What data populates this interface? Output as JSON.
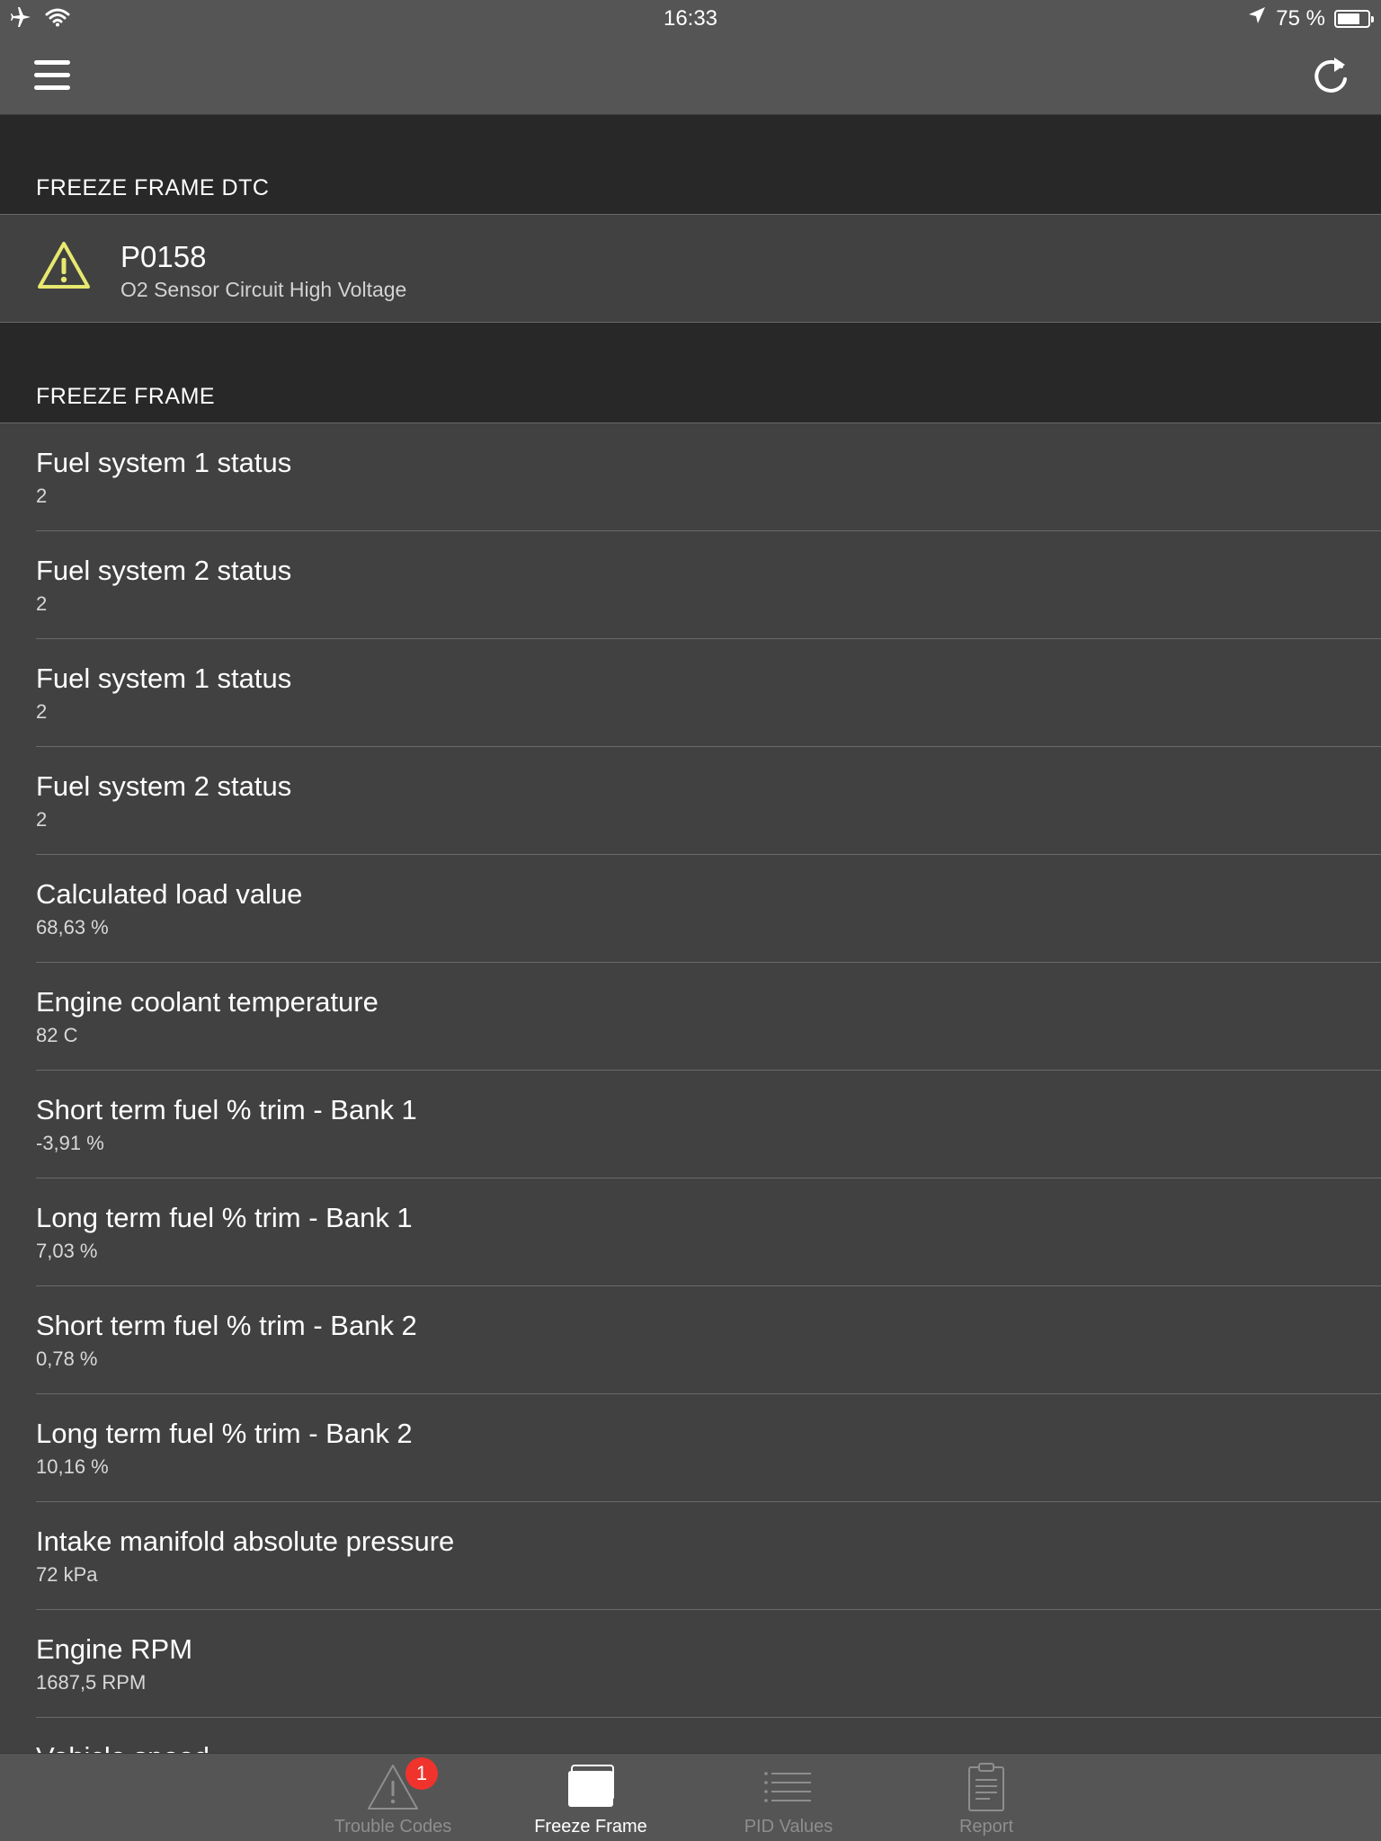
{
  "status_bar": {
    "time": "16:33",
    "battery_text": "75 %",
    "battery_level": 0.75,
    "icons": [
      "airplane-icon",
      "wifi-icon",
      "location-arrow-icon",
      "battery-icon"
    ]
  },
  "nav": {
    "icons": [
      "menu-icon",
      "refresh-icon"
    ]
  },
  "sections": {
    "dtc_header": "FREEZE FRAME DTC",
    "freeze_header": "FREEZE FRAME"
  },
  "dtc": {
    "code": "P0158",
    "description": "O2 Sensor Circuit High Voltage",
    "icon": "warning-triangle-icon",
    "icon_color": "#e7e86e"
  },
  "pids": [
    {
      "name": "Fuel system 1 status",
      "value": "2"
    },
    {
      "name": "Fuel system 2 status",
      "value": "2"
    },
    {
      "name": "Fuel system 1 status",
      "value": "2"
    },
    {
      "name": "Fuel system 2 status",
      "value": "2"
    },
    {
      "name": "Calculated load value",
      "value": "68,63 %"
    },
    {
      "name": "Engine coolant temperature",
      "value": "82 C"
    },
    {
      "name": "Short term fuel % trim - Bank 1",
      "value": "-3,91 %"
    },
    {
      "name": "Long term fuel % trim - Bank 1",
      "value": "7,03 %"
    },
    {
      "name": "Short term fuel % trim - Bank 2",
      "value": "0,78 %"
    },
    {
      "name": "Long term fuel % trim - Bank 2",
      "value": "10,16 %"
    },
    {
      "name": "Intake manifold absolute pressure",
      "value": "72 kPa"
    },
    {
      "name": "Engine RPM",
      "value": "1687,5 RPM"
    },
    {
      "name": "Vehicle speed",
      "value": ""
    }
  ],
  "tabs": [
    {
      "label": "Trouble Codes",
      "icon": "warning-triangle-icon",
      "badge": "1",
      "active": false
    },
    {
      "label": "Freeze Frame",
      "icon": "freeze-frame-icon",
      "active": true
    },
    {
      "label": "PID Values",
      "icon": "list-icon",
      "active": false
    },
    {
      "label": "Report",
      "icon": "clipboard-icon",
      "active": false
    }
  ],
  "colors": {
    "background": "#414141",
    "bars": "#555555",
    "section_header": "#282828",
    "badge": "#f0332c",
    "warning": "#e7e86e"
  }
}
